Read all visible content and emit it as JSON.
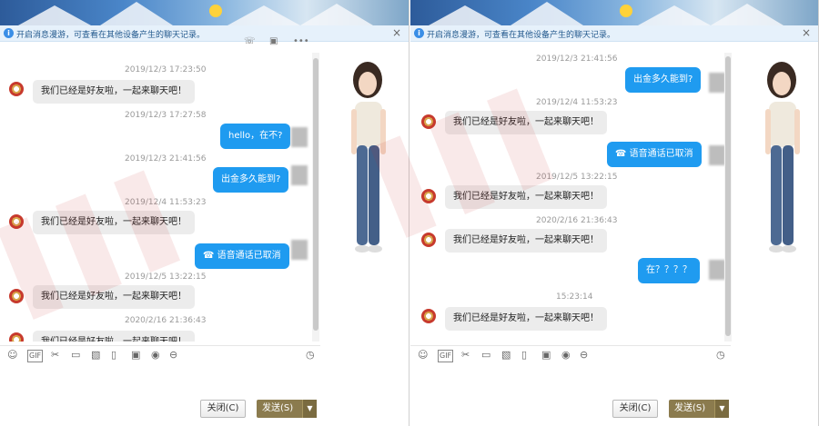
{
  "left": {
    "notice": "开启消息漫游，可查看在其他设备产生的聊天记录。",
    "messages": [
      {
        "time": "2019/12/3 17:23:50",
        "text": "我们已经是好友啦，一起来聊天吧！",
        "from": "in"
      },
      {
        "time": "2019/12/3 17:27:58",
        "text": "hello，在不?",
        "from": "out"
      },
      {
        "time": "2019/12/3 21:41:56",
        "text": "出金多久能到?",
        "from": "out"
      },
      {
        "time": "2019/12/4 11:53:23",
        "text": "我们已经是好友啦，一起来聊天吧！",
        "from": "in"
      },
      {
        "time": "",
        "text": "语音通话已取消",
        "from": "out"
      },
      {
        "time": "2019/12/5 13:22:15",
        "text": "我们已经是好友啦，一起来聊天吧！",
        "from": "in"
      },
      {
        "time": "2020/2/16 21:36:43",
        "text": "我们已经是好友啦，一起来聊天吧！",
        "from": "in"
      }
    ],
    "close_label": "关闭(C)",
    "send_label": "发送(S)"
  },
  "right": {
    "notice": "开启消息漫游，可查看在其他设备产生的聊天记录。",
    "messages": [
      {
        "time": "2019/12/3 21:41:56",
        "text": "出金多久能到?",
        "from": "out"
      },
      {
        "time": "2019/12/4 11:53:23",
        "text": "我们已经是好友啦，一起来聊天吧！",
        "from": "in"
      },
      {
        "time": "",
        "text": "语音通话已取消",
        "from": "out"
      },
      {
        "time": "2019/12/5 13:22:15",
        "text": "我们已经是好友啦，一起来聊天吧！",
        "from": "in"
      },
      {
        "time": "2020/2/16 21:36:43",
        "text": "我们已经是好友啦，一起来聊天吧！",
        "from": "in"
      },
      {
        "time": "",
        "text": "在？？？？",
        "from": "out"
      },
      {
        "time": "15:23:14",
        "text": "我们已经是好友啦，一起来聊天吧！",
        "from": "in"
      }
    ],
    "close_label": "关闭(C)",
    "send_label": "发送(S)"
  },
  "toolbar_icons": [
    "emoji-icon",
    "gif-icon",
    "scissors-icon",
    "folder-icon",
    "image-icon",
    "screenshot-icon",
    "gift-icon",
    "music-icon",
    "more-icon",
    "history-icon"
  ],
  "accent": "#1f9bf0",
  "send_color": "#8b7b4e"
}
